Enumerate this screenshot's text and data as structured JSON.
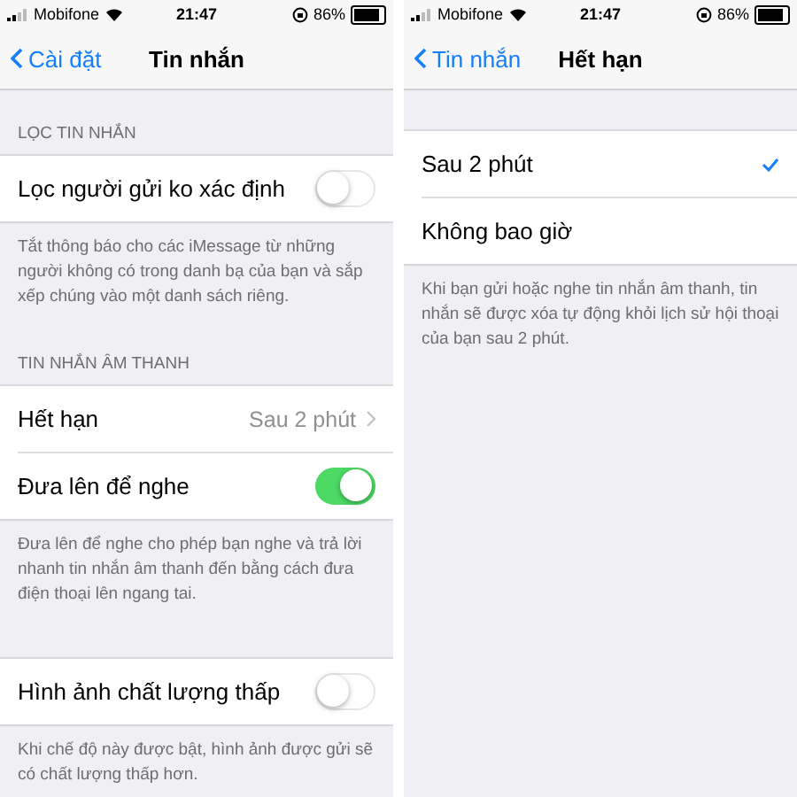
{
  "screens": [
    {
      "status_bar": {
        "carrier": "Mobifone",
        "time": "21:47",
        "battery_text": "86%"
      },
      "nav": {
        "back": "Cài đặt",
        "title": "Tin nhắn"
      },
      "groups": [
        {
          "header": "LỌC TIN NHẮN",
          "rows": [
            {
              "kind": "toggle",
              "label": "Lọc người gửi ko xác định",
              "on": false
            }
          ],
          "footer": "Tắt thông báo cho các iMessage từ những người không có trong danh bạ của bạn và sắp xếp chúng vào một danh sách riêng."
        },
        {
          "header": "TIN NHẮN ÂM THANH",
          "rows": [
            {
              "kind": "value",
              "label": "Hết hạn",
              "value": "Sau 2 phút"
            },
            {
              "kind": "toggle",
              "label": "Đưa lên để nghe",
              "on": true
            }
          ],
          "footer": "Đưa lên để nghe cho phép bạn nghe và trả lời nhanh tin nhắn âm thanh đến bằng cách đưa điện thoại lên ngang tai."
        },
        {
          "rows": [
            {
              "kind": "toggle",
              "label": "Hình ảnh chất lượng thấp",
              "on": false
            }
          ],
          "footer": "Khi chế độ này được bật, hình ảnh được gửi sẽ có chất lượng thấp hơn."
        }
      ]
    },
    {
      "status_bar": {
        "carrier": "Mobifone",
        "time": "21:47",
        "battery_text": "86%"
      },
      "nav": {
        "back": "Tin nhắn",
        "title": "Hết hạn"
      },
      "groups": [
        {
          "rows": [
            {
              "kind": "check",
              "label": "Sau 2 phút",
              "selected": true
            },
            {
              "kind": "check",
              "label": "Không bao giờ",
              "selected": false
            }
          ],
          "footer": "Khi bạn gửi hoặc nghe tin nhắn âm thanh, tin nhắn sẽ được xóa tự động khỏi lịch sử hội thoại của bạn sau 2 phút."
        }
      ]
    }
  ]
}
